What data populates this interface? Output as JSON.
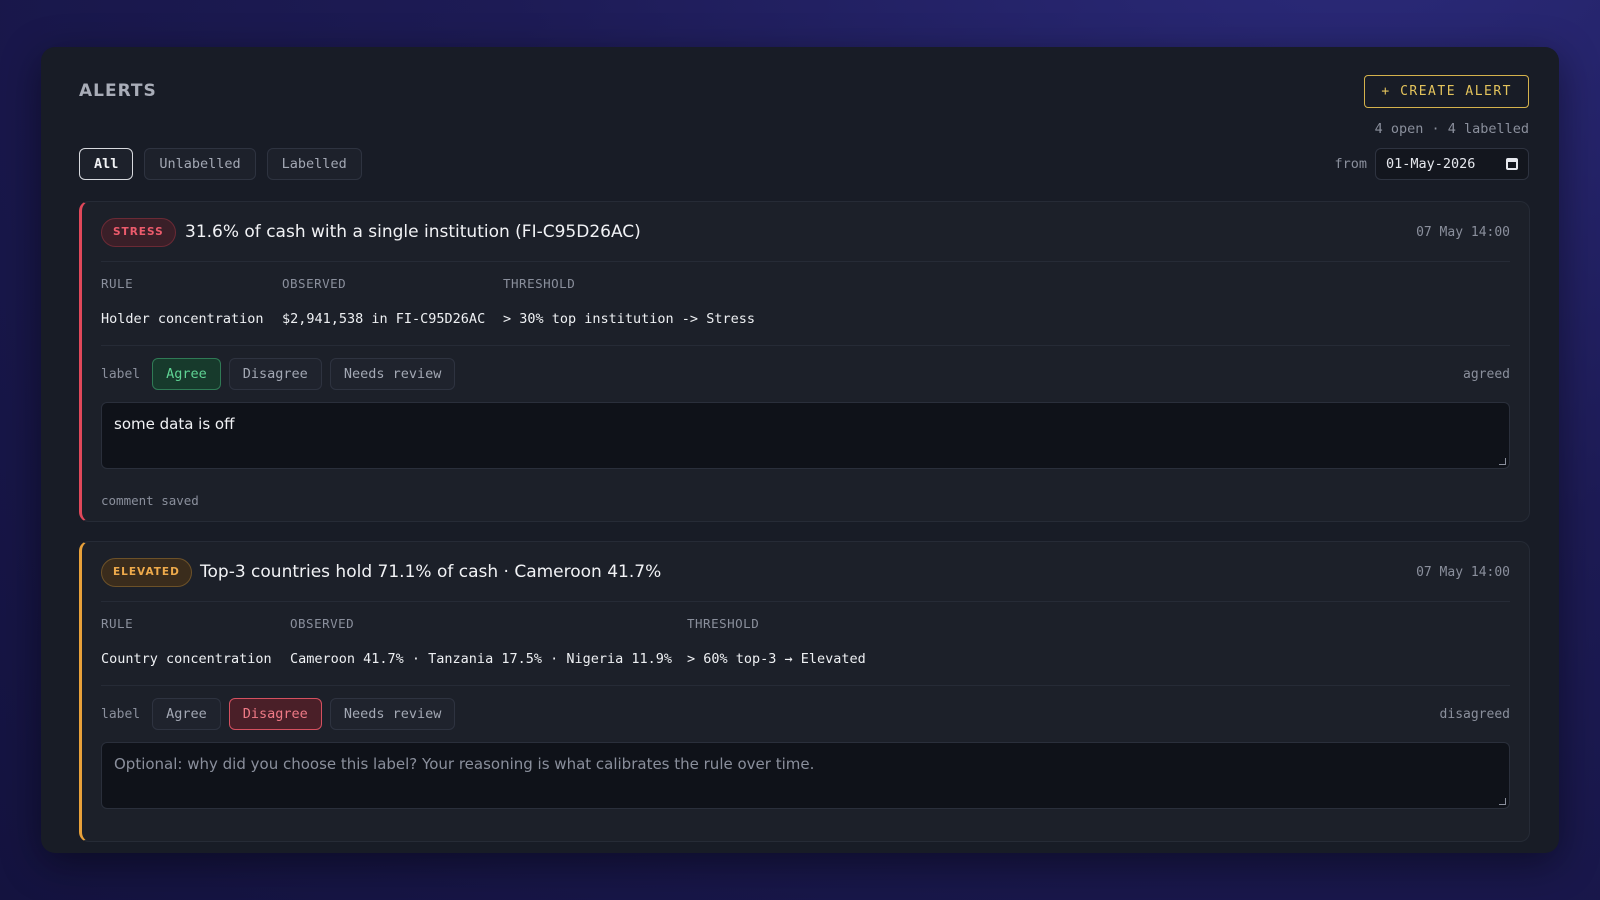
{
  "header": {
    "title": "ALERTS",
    "create_label": "+ CREATE ALERT",
    "counts": "4 open · 4 labelled"
  },
  "filters": [
    {
      "label": "All",
      "active": true
    },
    {
      "label": "Unlabelled",
      "active": false
    },
    {
      "label": "Labelled",
      "active": false
    }
  ],
  "date_filter": {
    "label": "from",
    "value": "01-May-2026"
  },
  "columns": {
    "rule": "RULE",
    "observed": "OBSERVED",
    "threshold": "THRESHOLD"
  },
  "label_options": {
    "prefix": "label",
    "agree": "Agree",
    "disagree": "Disagree",
    "review": "Needs review"
  },
  "alerts": [
    {
      "severity": "STRESS",
      "title": "31.6% of cash with a single institution (FI-C95D26AC)",
      "time": "07 May 14:00",
      "rule": "Holder concentration",
      "observed": "$2,941,538 in FI-C95D26AC",
      "threshold": "> 30% top institution -> Stress",
      "label_state": "agreed",
      "selected_label": "agree",
      "comment": "some data is off",
      "comment_placeholder": "",
      "status": "comment saved",
      "accent": "#e0485a"
    },
    {
      "severity": "ELEVATED",
      "title": "Top-3 countries hold 71.1% of cash · Cameroon 41.7%",
      "time": "07 May 14:00",
      "rule": "Country concentration",
      "observed": "Cameroon 41.7% · Tanzania 17.5% · Nigeria 11.9%",
      "threshold": "> 60% top-3 → Elevated",
      "label_state": "disagreed",
      "selected_label": "disagree",
      "comment": "",
      "comment_placeholder": "Optional: why did you choose this label? Your reasoning is what calibrates the rule over time.",
      "status": "",
      "accent": "#e8a13a"
    }
  ]
}
